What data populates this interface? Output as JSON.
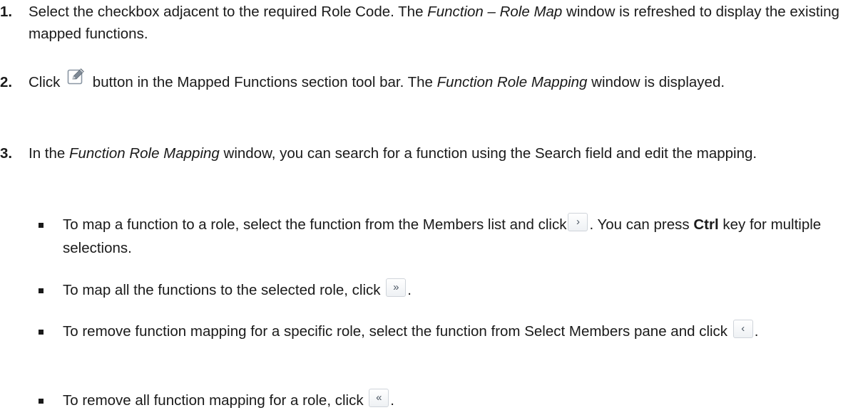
{
  "steps": [
    {
      "num": "1.",
      "t1": "Select the checkbox adjacent to the required Role Code. The ",
      "em1": "Function – Role Map",
      "t2": " window is refreshed to display the existing mapped functions."
    },
    {
      "num": "2.",
      "t1": "Click ",
      "t2": " button in the Mapped Functions section tool bar. The ",
      "em1": "Function Role Mapping",
      "t3": " window is displayed."
    },
    {
      "num": "3.",
      "t1": "In the ",
      "em1": "Function Role Mapping",
      "t2": " window, you can search for a function using the Search field and edit the mapping."
    }
  ],
  "bullets": [
    {
      "t1": "To map a function to a role, select the function from the Members list and click",
      "icon": "›",
      "t2": ". You can press ",
      "bold": "Ctrl",
      "t3": " key for multiple selections."
    },
    {
      "t1": "To map all the functions to the selected role, click ",
      "icon": "»",
      "t2": "."
    },
    {
      "t1": "To remove function mapping for a specific role, select the function from Select Members pane and click ",
      "icon": "‹",
      "t2": "."
    },
    {
      "t1": "To remove all function mapping for a role, click ",
      "icon": "«",
      "t2": "."
    }
  ],
  "icons": {
    "edit": "edit-icon",
    "move_right": "chevron-right-icon",
    "move_all_right": "double-chevron-right-icon",
    "move_left": "chevron-left-icon",
    "move_all_left": "double-chevron-left-icon"
  }
}
